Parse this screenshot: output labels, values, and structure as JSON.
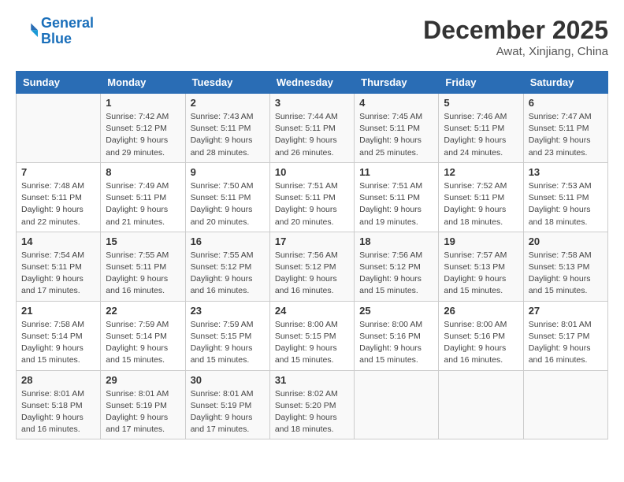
{
  "logo": {
    "line1": "General",
    "line2": "Blue"
  },
  "title": "December 2025",
  "location": "Awat, Xinjiang, China",
  "weekdays": [
    "Sunday",
    "Monday",
    "Tuesday",
    "Wednesday",
    "Thursday",
    "Friday",
    "Saturday"
  ],
  "weeks": [
    [
      {
        "day": "",
        "info": ""
      },
      {
        "day": "1",
        "info": "Sunrise: 7:42 AM\nSunset: 5:12 PM\nDaylight: 9 hours\nand 29 minutes."
      },
      {
        "day": "2",
        "info": "Sunrise: 7:43 AM\nSunset: 5:11 PM\nDaylight: 9 hours\nand 28 minutes."
      },
      {
        "day": "3",
        "info": "Sunrise: 7:44 AM\nSunset: 5:11 PM\nDaylight: 9 hours\nand 26 minutes."
      },
      {
        "day": "4",
        "info": "Sunrise: 7:45 AM\nSunset: 5:11 PM\nDaylight: 9 hours\nand 25 minutes."
      },
      {
        "day": "5",
        "info": "Sunrise: 7:46 AM\nSunset: 5:11 PM\nDaylight: 9 hours\nand 24 minutes."
      },
      {
        "day": "6",
        "info": "Sunrise: 7:47 AM\nSunset: 5:11 PM\nDaylight: 9 hours\nand 23 minutes."
      }
    ],
    [
      {
        "day": "7",
        "info": "Sunrise: 7:48 AM\nSunset: 5:11 PM\nDaylight: 9 hours\nand 22 minutes."
      },
      {
        "day": "8",
        "info": "Sunrise: 7:49 AM\nSunset: 5:11 PM\nDaylight: 9 hours\nand 21 minutes."
      },
      {
        "day": "9",
        "info": "Sunrise: 7:50 AM\nSunset: 5:11 PM\nDaylight: 9 hours\nand 20 minutes."
      },
      {
        "day": "10",
        "info": "Sunrise: 7:51 AM\nSunset: 5:11 PM\nDaylight: 9 hours\nand 20 minutes."
      },
      {
        "day": "11",
        "info": "Sunrise: 7:51 AM\nSunset: 5:11 PM\nDaylight: 9 hours\nand 19 minutes."
      },
      {
        "day": "12",
        "info": "Sunrise: 7:52 AM\nSunset: 5:11 PM\nDaylight: 9 hours\nand 18 minutes."
      },
      {
        "day": "13",
        "info": "Sunrise: 7:53 AM\nSunset: 5:11 PM\nDaylight: 9 hours\nand 18 minutes."
      }
    ],
    [
      {
        "day": "14",
        "info": "Sunrise: 7:54 AM\nSunset: 5:11 PM\nDaylight: 9 hours\nand 17 minutes."
      },
      {
        "day": "15",
        "info": "Sunrise: 7:55 AM\nSunset: 5:11 PM\nDaylight: 9 hours\nand 16 minutes."
      },
      {
        "day": "16",
        "info": "Sunrise: 7:55 AM\nSunset: 5:12 PM\nDaylight: 9 hours\nand 16 minutes."
      },
      {
        "day": "17",
        "info": "Sunrise: 7:56 AM\nSunset: 5:12 PM\nDaylight: 9 hours\nand 16 minutes."
      },
      {
        "day": "18",
        "info": "Sunrise: 7:56 AM\nSunset: 5:12 PM\nDaylight: 9 hours\nand 15 minutes."
      },
      {
        "day": "19",
        "info": "Sunrise: 7:57 AM\nSunset: 5:13 PM\nDaylight: 9 hours\nand 15 minutes."
      },
      {
        "day": "20",
        "info": "Sunrise: 7:58 AM\nSunset: 5:13 PM\nDaylight: 9 hours\nand 15 minutes."
      }
    ],
    [
      {
        "day": "21",
        "info": "Sunrise: 7:58 AM\nSunset: 5:14 PM\nDaylight: 9 hours\nand 15 minutes."
      },
      {
        "day": "22",
        "info": "Sunrise: 7:59 AM\nSunset: 5:14 PM\nDaylight: 9 hours\nand 15 minutes."
      },
      {
        "day": "23",
        "info": "Sunrise: 7:59 AM\nSunset: 5:15 PM\nDaylight: 9 hours\nand 15 minutes."
      },
      {
        "day": "24",
        "info": "Sunrise: 8:00 AM\nSunset: 5:15 PM\nDaylight: 9 hours\nand 15 minutes."
      },
      {
        "day": "25",
        "info": "Sunrise: 8:00 AM\nSunset: 5:16 PM\nDaylight: 9 hours\nand 15 minutes."
      },
      {
        "day": "26",
        "info": "Sunrise: 8:00 AM\nSunset: 5:16 PM\nDaylight: 9 hours\nand 16 minutes."
      },
      {
        "day": "27",
        "info": "Sunrise: 8:01 AM\nSunset: 5:17 PM\nDaylight: 9 hours\nand 16 minutes."
      }
    ],
    [
      {
        "day": "28",
        "info": "Sunrise: 8:01 AM\nSunset: 5:18 PM\nDaylight: 9 hours\nand 16 minutes."
      },
      {
        "day": "29",
        "info": "Sunrise: 8:01 AM\nSunset: 5:19 PM\nDaylight: 9 hours\nand 17 minutes."
      },
      {
        "day": "30",
        "info": "Sunrise: 8:01 AM\nSunset: 5:19 PM\nDaylight: 9 hours\nand 17 minutes."
      },
      {
        "day": "31",
        "info": "Sunrise: 8:02 AM\nSunset: 5:20 PM\nDaylight: 9 hours\nand 18 minutes."
      },
      {
        "day": "",
        "info": ""
      },
      {
        "day": "",
        "info": ""
      },
      {
        "day": "",
        "info": ""
      }
    ]
  ]
}
